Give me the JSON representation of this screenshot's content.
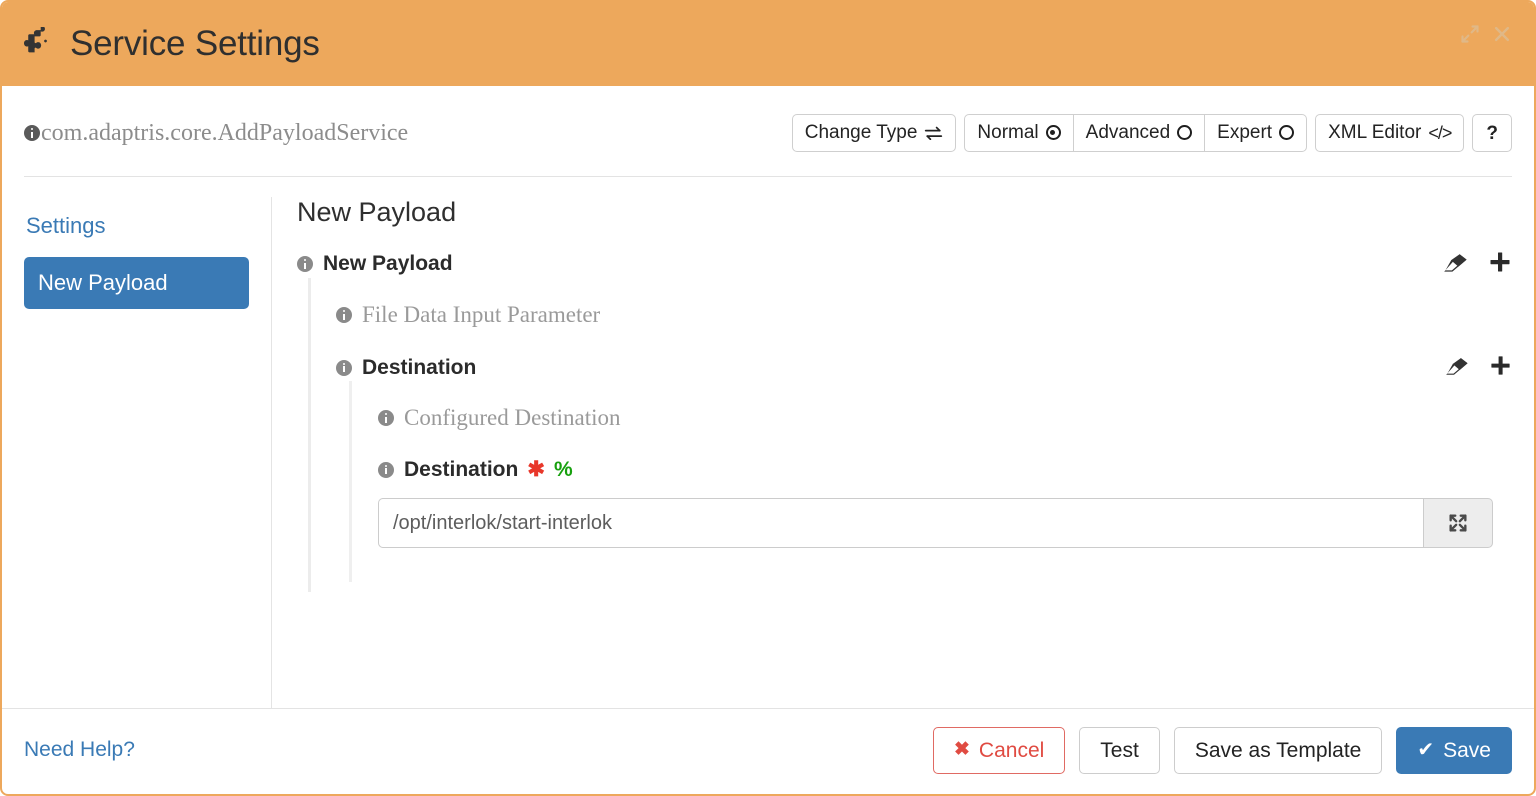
{
  "window": {
    "title": "Service Settings",
    "icon": "puzzle-piece-icon",
    "expand_icon": "expand-icon",
    "close_icon": "close-icon",
    "border_color": "#eda85c",
    "titlebar_color": "#eda85c"
  },
  "header": {
    "class_name": "com.adaptris.core.AddPayloadService",
    "info_icon": "info-icon",
    "buttons": {
      "change_type": "Change Type",
      "change_type_icon": "swap-arrows-icon",
      "normal": "Normal",
      "advanced": "Advanced",
      "expert": "Expert",
      "xml_editor": "XML Editor",
      "xml_editor_icon": "code-icon",
      "help": "?"
    },
    "selected_mode": "Normal"
  },
  "sidebar": {
    "items": [
      {
        "label": "Settings",
        "active": false
      },
      {
        "label": "New Payload",
        "active": true
      }
    ]
  },
  "main": {
    "title": "New Payload",
    "sections": [
      {
        "label": "New Payload",
        "style": "bold",
        "actions": [
          "eraser-icon",
          "plus-icon"
        ]
      },
      {
        "label": "File Data Input Parameter",
        "style": "muted"
      },
      {
        "label": "Destination",
        "style": "bold",
        "actions": [
          "eraser-icon",
          "plus-icon"
        ]
      },
      {
        "label": "Configured Destination",
        "style": "muted"
      }
    ],
    "field": {
      "label": "Destination",
      "required_marker": "✱",
      "percent_marker": "%",
      "value": "/opt/interlok/start-interlok",
      "placeholder": "",
      "expand_button_icon": "expand-arrows-icon"
    }
  },
  "footer": {
    "need_help": "Need Help?",
    "cancel": "Cancel",
    "cancel_icon": "✖",
    "test": "Test",
    "save_as_template": "Save as Template",
    "save": "Save",
    "save_icon": "✔"
  },
  "colors": {
    "accent_orange": "#eda85c",
    "primary_blue": "#3a7ab5",
    "danger_red": "#e04b42",
    "required_red": "#e8372a",
    "percent_green": "#17a00e"
  }
}
